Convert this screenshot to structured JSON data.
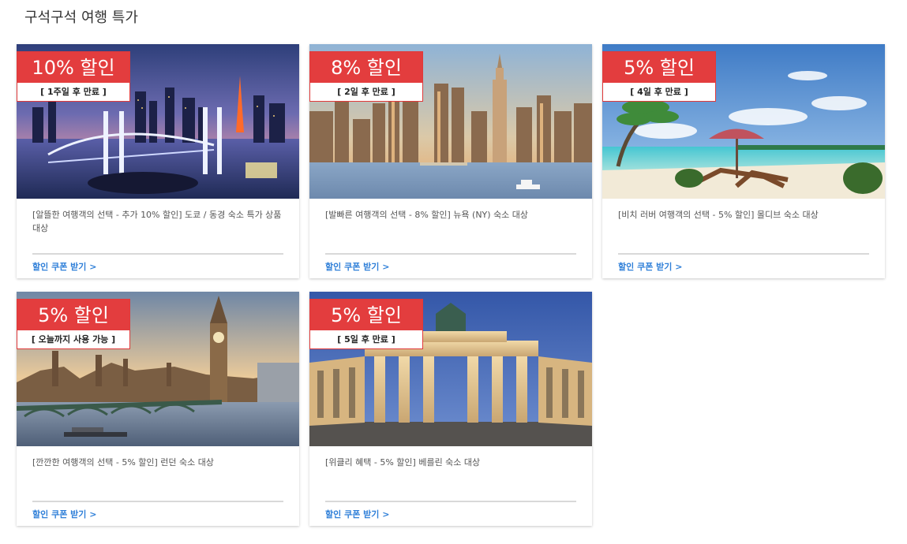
{
  "page": {
    "title": "구석구석 여행 특가"
  },
  "deals": [
    {
      "city": "tokyo",
      "discount": "10% 할인",
      "expiry": "[ 1주일 후 만료 ]",
      "description": "[알뜰한 여행객의 선택 - 추가 10% 할인] 도쿄 / 동경 숙소 특가 상품 대상",
      "link": "할인 쿠폰 받기 >"
    },
    {
      "city": "new-york",
      "discount": "8% 할인",
      "expiry": "[ 2일 후 만료 ]",
      "description": "[발빠른 여행객의 선택 - 8% 할인] 뉴욕 (NY) 숙소 대상",
      "link": "할인 쿠폰 받기 >"
    },
    {
      "city": "maldives",
      "discount": "5% 할인",
      "expiry": "[ 4일 후 만료 ]",
      "description": "[비치 러버 여행객의 선택 - 5% 할인] 몰디브 숙소 대상",
      "link": "할인 쿠폰 받기 >"
    },
    {
      "city": "london",
      "discount": "5% 할인",
      "expiry": "[ 오늘까지 사용 가능 ]",
      "description": "[깐깐한 여행객의 선택 - 5% 할인] 런던 숙소 대상",
      "link": "할인 쿠폰 받기 >"
    },
    {
      "city": "berlin",
      "discount": "5% 할인",
      "expiry": "[ 5일 후 만료 ]",
      "description": "[위클리 혜택 - 5% 할인] 베를린 숙소 대상",
      "link": "할인 쿠폰 받기 >"
    }
  ],
  "colors": {
    "badge": "#e33d3e",
    "link": "#2f7fd8"
  }
}
